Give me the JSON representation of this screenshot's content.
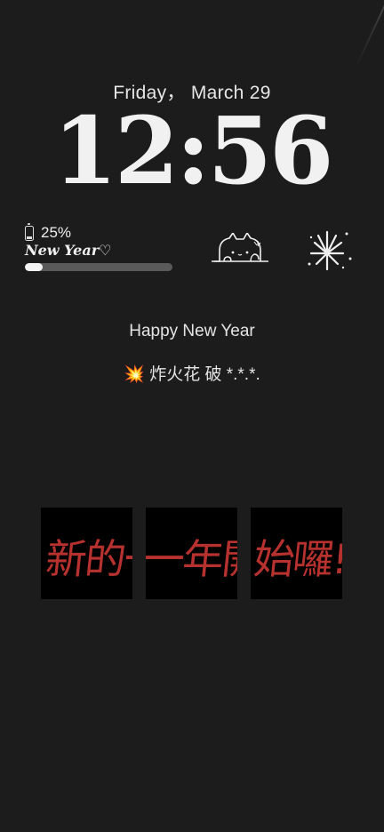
{
  "lockscreen": {
    "date": "Friday， March 29",
    "time": "12:56"
  },
  "battery_widget": {
    "icon": "phone-battery-icon",
    "percent_label": "25%",
    "level": 0.12,
    "caption": "New Year♡"
  },
  "stickers": [
    "cat-peeking-icon",
    "fireworks-icon"
  ],
  "messages": {
    "greeting": "Happy New Year",
    "burst_emoji": "💥",
    "burst_text": "炸火花 破 *.*.*."
  },
  "banner": {
    "text": "新的一年開始囉!",
    "cards": [
      "新的一",
      "一年開",
      "始囉!"
    ],
    "text_color": "#b7322e"
  }
}
